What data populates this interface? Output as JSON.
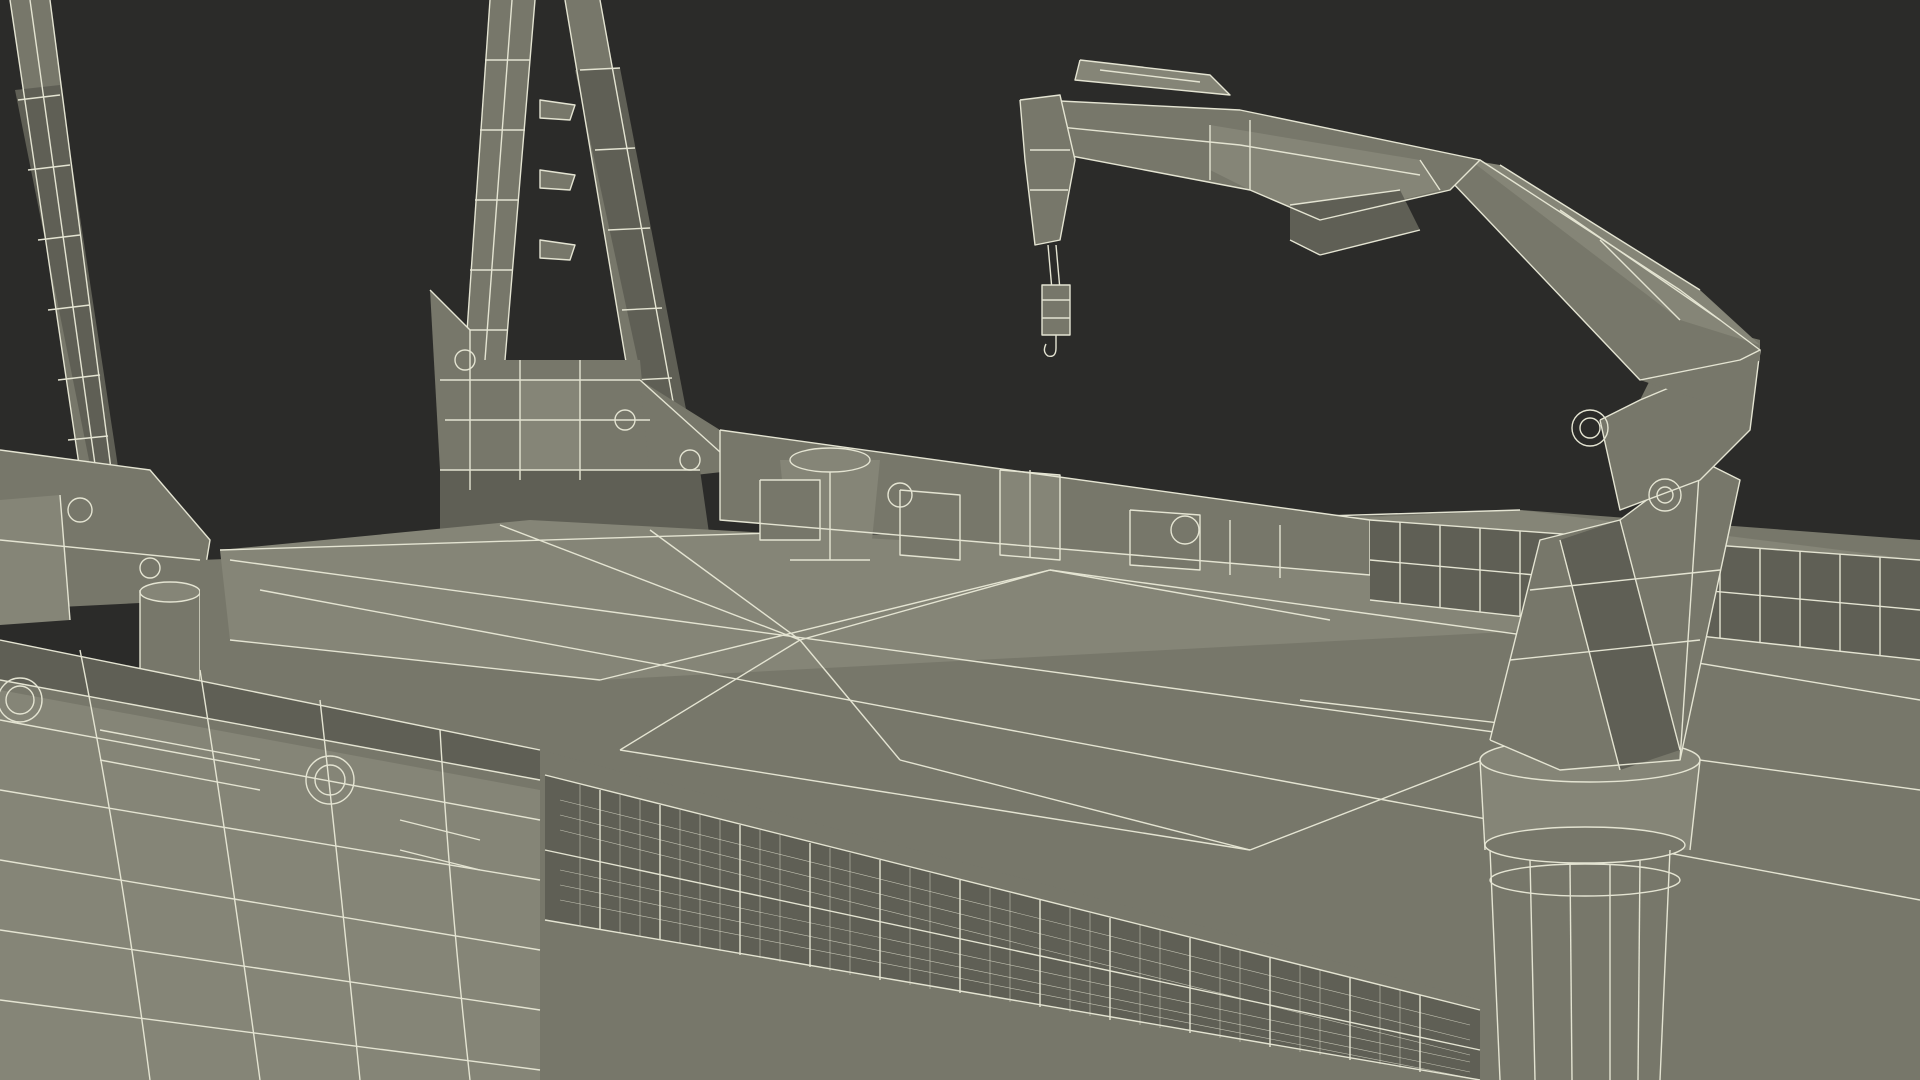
{
  "scene": {
    "subject": "wireframe-render-ship-deck-with-knuckle-boom-crane",
    "colors": {
      "background": "#2b2b29",
      "surface": "#77776a",
      "surface_light": "#858577",
      "surface_dark": "#5f5f55",
      "wire": "#e4e4d2",
      "shadow": "#2f2f2b"
    }
  }
}
